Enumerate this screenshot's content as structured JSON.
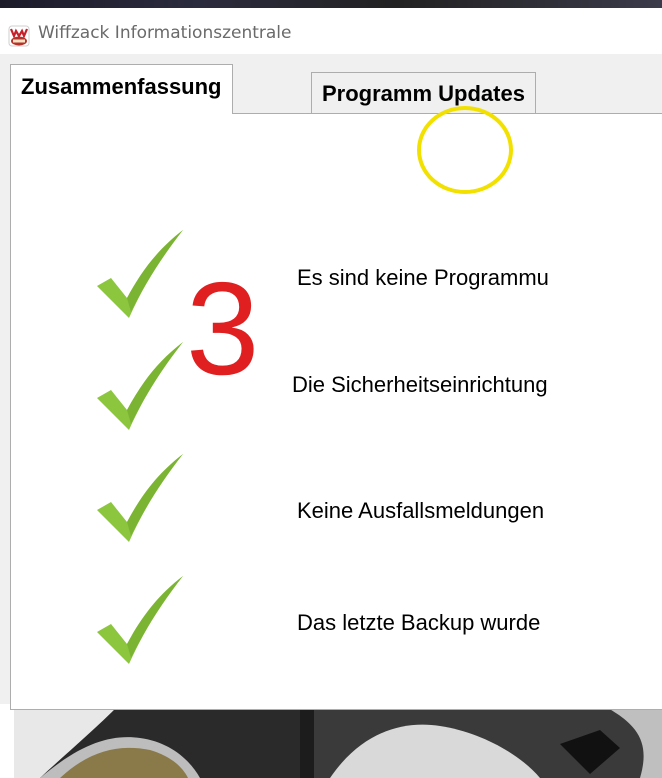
{
  "window": {
    "title": "Wiffzack Informationszentrale",
    "icon": "wiffzack-app-icon"
  },
  "tabs": [
    {
      "label": "Zusammenfassung",
      "active": true
    },
    {
      "label": "Programm Updates",
      "active": false
    }
  ],
  "status_items": [
    {
      "text": "Es sind keine Programmu",
      "icon": "green-checkmark-icon"
    },
    {
      "text": "Die Sicherheitseinrichtung",
      "icon": "green-checkmark-icon"
    },
    {
      "text": "Keine Ausfallsmeldungen",
      "icon": "green-checkmark-icon"
    },
    {
      "text": "Das letzte Backup wurde",
      "icon": "green-checkmark-icon"
    }
  ],
  "annotations": {
    "step_number": "3",
    "circle_color": "#f2e100",
    "number_color": "#e02020"
  },
  "colors": {
    "check_green": "#8cc63f",
    "window_bg": "#f0f0f0"
  }
}
